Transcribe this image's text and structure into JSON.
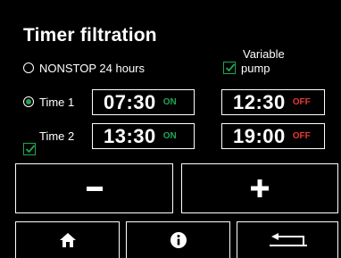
{
  "title": "Timer filtration",
  "options": {
    "nonstop_label": "NONSTOP 24 hours",
    "variable_pump_label_1": "Variable",
    "variable_pump_label_2": "pump"
  },
  "timers": [
    {
      "label": "Time 1",
      "start": "07:30",
      "start_state": "ON",
      "end": "12:30",
      "end_state": "OFF"
    },
    {
      "label": "Time 2",
      "start": "13:30",
      "start_state": "ON",
      "end": "19:00",
      "end_state": "OFF"
    }
  ],
  "controls": {
    "minus": "−",
    "plus": "+"
  },
  "colors": {
    "accent_green": "#1fa653",
    "off_red": "#e53935",
    "background": "#000000"
  },
  "icons": [
    "home-icon",
    "info-icon",
    "back-icon"
  ]
}
